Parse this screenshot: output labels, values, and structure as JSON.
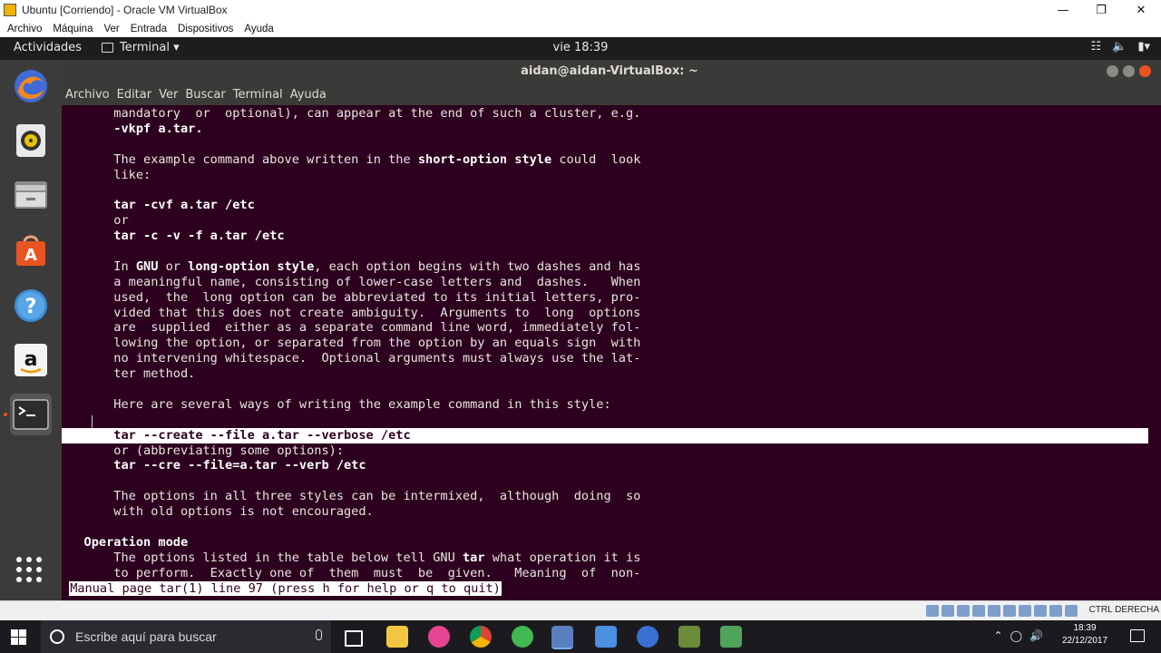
{
  "vbox": {
    "title": "Ubuntu  [Corriendo] - Oracle VM VirtualBox",
    "menu": [
      "Archivo",
      "Máquina",
      "Ver",
      "Entrada",
      "Dispositivos",
      "Ayuda"
    ],
    "hostkey": "CTRL DERECHA"
  },
  "topbar": {
    "activities": "Actividades",
    "app_menu": "Terminal ▾",
    "clock": "vie 18:39",
    "tray_icons": [
      "network-icon",
      "volume-icon",
      "battery-icon",
      "power-menu-icon"
    ]
  },
  "dock": {
    "items": [
      "firefox-icon",
      "rhythmbox-icon",
      "files-icon",
      "software-center-icon",
      "help-icon",
      "amazon-icon",
      "terminal-icon"
    ]
  },
  "terminal": {
    "title": "aidan@aidan-VirtualBox: ~",
    "menu": [
      "Archivo",
      "Editar",
      "Ver",
      "Buscar",
      "Terminal",
      "Ayuda"
    ]
  },
  "manpage": {
    "l01": "       mandatory  or  optional), can appear at the end of such a cluster, e.g.",
    "l02": "       -vkpf a.tar.",
    "l03": "",
    "l04a": "       The example command above written in the ",
    "l04b": "short-option style",
    "l04c": " could  look",
    "l05": "       like:",
    "l06": "",
    "l07": "       tar -cvf a.tar /etc",
    "l08": "       or",
    "l09": "       tar -c -v -f a.tar /etc",
    "l10": "",
    "l11a": "       In ",
    "l11b": "GNU",
    "l11c": " or ",
    "l11d": "long-option style",
    "l11e": ", each option begins with two dashes and has",
    "l12": "       a meaningful name, consisting of lower-case letters and  dashes.   When",
    "l13": "       used,  the  long option can be abbreviated to its initial letters, pro‐",
    "l14": "       vided that this does not create ambiguity.  Arguments to  long  options",
    "l15": "       are  supplied  either as a separate command line word, immediately fol‐",
    "l16": "       lowing the option, or separated from the option by an equals sign  with",
    "l17": "       no intervening whitespace.  Optional arguments must always use the lat‐",
    "l18": "       ter method.",
    "l19": "",
    "l20": "       Here are several ways of writing the example command in this style:",
    "l21": "",
    "l22": "       tar --create --file a.tar --verbose /etc",
    "l23": "       or (abbreviating some options):",
    "l24": "       tar --cre --file=a.tar --verb /etc",
    "l25": "",
    "l26": "       The options in all three styles can be intermixed,  although  doing  so",
    "l27": "       with old options is not encouraged.",
    "l28": "",
    "l29": "   Operation mode",
    "l30a": "       The options listed in the table below tell GNU ",
    "l30b": "tar",
    "l30c": " what operation it is",
    "l31": "       to perform.  Exactly one of  them  must  be  given.   Meaning  of  non‐",
    "status": "Manual page tar(1) line 97 (press h for help or q to quit)"
  },
  "taskbar": {
    "search_placeholder": "Escribe aquí para buscar",
    "apps": [
      "task-view-icon",
      "file-explorer-icon",
      "music-player-icon",
      "chrome-icon",
      "globe-app-icon",
      "virtualbox-icon",
      "mail-icon",
      "edge-icon",
      "app-icon-1",
      "app-icon-2"
    ],
    "time": "18:39",
    "date": "22/12/2017"
  },
  "colors": {
    "terminal_bg": "#2c001e",
    "ubuntu_orange": "#e95420"
  }
}
